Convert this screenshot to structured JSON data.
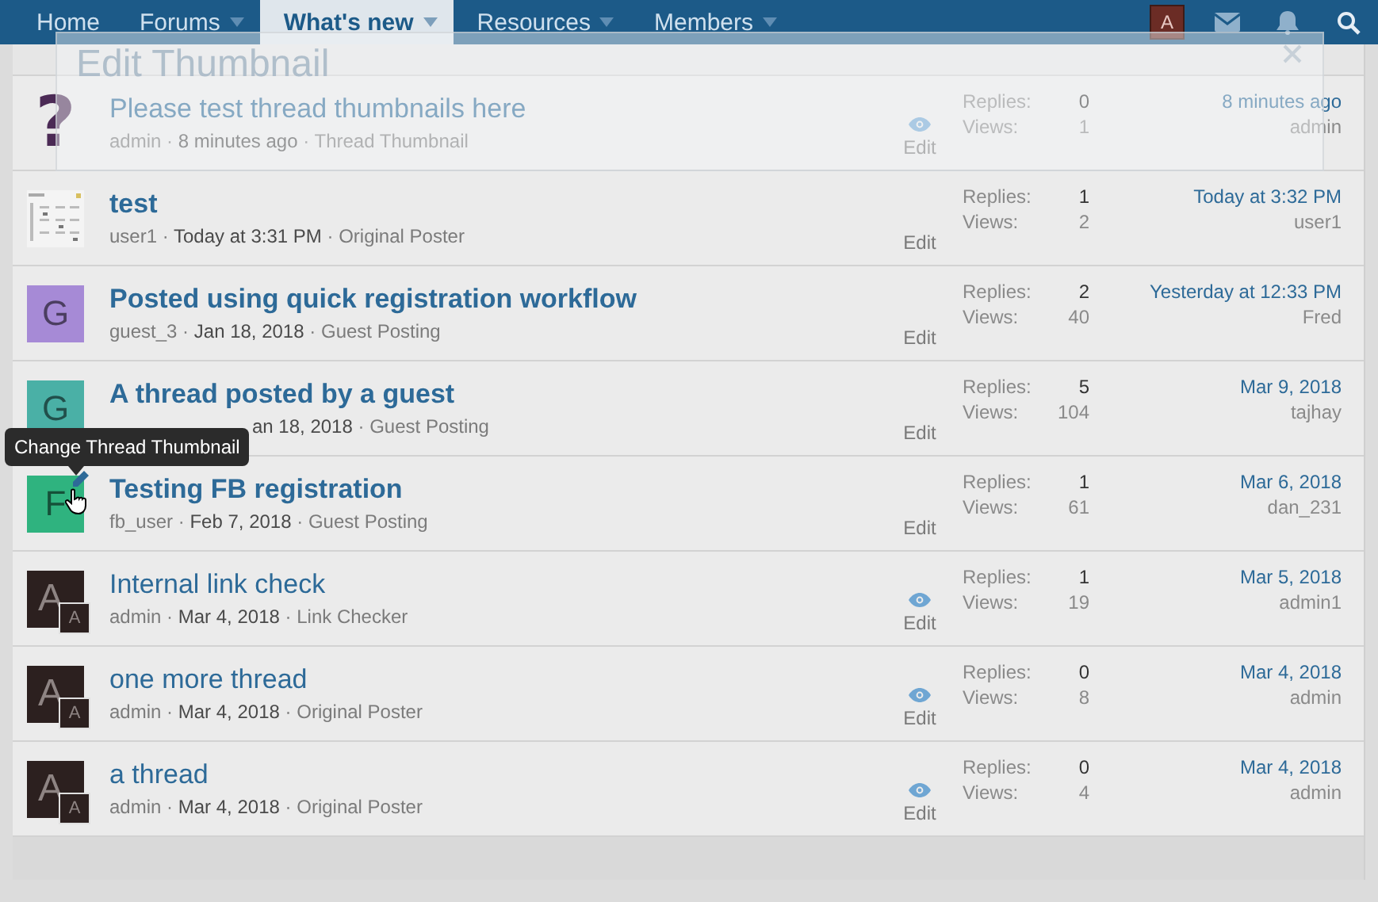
{
  "nav": {
    "items": [
      {
        "label": "Home",
        "selected": false,
        "dropdown": false
      },
      {
        "label": "Forums",
        "selected": false,
        "dropdown": true
      },
      {
        "label": "What's new",
        "selected": true,
        "dropdown": true
      },
      {
        "label": "Resources",
        "selected": false,
        "dropdown": true
      },
      {
        "label": "Members",
        "selected": false,
        "dropdown": true
      }
    ],
    "user_avatar": "A"
  },
  "dialog": {
    "title": "Edit Thumbnail"
  },
  "threads": [
    {
      "avatar": {
        "kind": "question",
        "text": "?"
      },
      "title": "Please test thread thumbnails here",
      "unread": false,
      "meta": [
        {
          "kind": "user",
          "text": "admin"
        },
        {
          "kind": "sep",
          "text": "·"
        },
        {
          "kind": "date",
          "text": "8 minutes ago"
        },
        {
          "kind": "sep",
          "text": "·"
        },
        {
          "kind": "forum",
          "text": "Thread Thumbnail"
        }
      ],
      "preview": true,
      "edit": "Edit",
      "replies_label": "Replies:",
      "replies": "0",
      "views_label": "Views:",
      "views": "1",
      "last_date": "8 minutes ago",
      "last_user": "admin",
      "editing": false
    },
    {
      "avatar": {
        "kind": "image"
      },
      "title": "test",
      "unread": true,
      "meta": [
        {
          "kind": "user",
          "text": "user1"
        },
        {
          "kind": "sep",
          "text": "·"
        },
        {
          "kind": "date",
          "text": "Today at 3:31 PM"
        },
        {
          "kind": "sep",
          "text": "·"
        },
        {
          "kind": "forum",
          "text": "Original Poster"
        }
      ],
      "preview": false,
      "edit": "Edit",
      "replies_label": "Replies:",
      "replies": "1",
      "views_label": "Views:",
      "views": "2",
      "last_date": "Today at 3:32 PM",
      "last_user": "user1",
      "editing": false
    },
    {
      "avatar": {
        "kind": "letter",
        "text": "G",
        "color": "#a68ad6"
      },
      "title": "Posted using quick registration workflow",
      "unread": true,
      "meta": [
        {
          "kind": "user",
          "text": "guest_3"
        },
        {
          "kind": "sep",
          "text": "·"
        },
        {
          "kind": "date",
          "text": "Jan 18, 2018"
        },
        {
          "kind": "sep",
          "text": "·"
        },
        {
          "kind": "forum",
          "text": "Guest Posting"
        }
      ],
      "preview": false,
      "edit": "Edit",
      "replies_label": "Replies:",
      "replies": "2",
      "views_label": "Views:",
      "views": "40",
      "last_date": "Yesterday at 12:33 PM",
      "last_user": "Fred",
      "editing": false
    },
    {
      "avatar": {
        "kind": "letter",
        "text": "G",
        "color": "#4ab0a6"
      },
      "title": "A thread posted by a guest",
      "unread": true,
      "meta": [
        {
          "kind": "date",
          "text": "an 18, 2018"
        },
        {
          "kind": "sep",
          "text": "·"
        },
        {
          "kind": "forum",
          "text": "Guest Posting"
        }
      ],
      "preview": false,
      "edit": "Edit",
      "replies_label": "Replies:",
      "replies": "5",
      "views_label": "Views:",
      "views": "104",
      "last_date": "Mar 9, 2018",
      "last_user": "tajhay",
      "editing": false
    },
    {
      "avatar": {
        "kind": "letter",
        "text": "F",
        "color": "#2fb37f"
      },
      "title": "Testing FB registration",
      "unread": true,
      "meta": [
        {
          "kind": "user",
          "text": "fb_user"
        },
        {
          "kind": "sep",
          "text": "·"
        },
        {
          "kind": "date",
          "text": "Feb 7, 2018"
        },
        {
          "kind": "sep",
          "text": "·"
        },
        {
          "kind": "forum",
          "text": "Guest Posting"
        }
      ],
      "preview": false,
      "edit": "Edit",
      "replies_label": "Replies:",
      "replies": "1",
      "views_label": "Views:",
      "views": "61",
      "last_date": "Mar 6, 2018",
      "last_user": "dan_231",
      "editing": true
    },
    {
      "avatar": {
        "kind": "badge",
        "text": "A",
        "badge": "A"
      },
      "title": "Internal link check",
      "unread": false,
      "meta": [
        {
          "kind": "user",
          "text": "admin"
        },
        {
          "kind": "sep",
          "text": "·"
        },
        {
          "kind": "date",
          "text": "Mar 4, 2018"
        },
        {
          "kind": "sep",
          "text": "·"
        },
        {
          "kind": "forum",
          "text": "Link Checker"
        }
      ],
      "preview": true,
      "edit": "Edit",
      "replies_label": "Replies:",
      "replies": "1",
      "views_label": "Views:",
      "views": "19",
      "last_date": "Mar 5, 2018",
      "last_user": "admin1",
      "editing": false
    },
    {
      "avatar": {
        "kind": "badge",
        "text": "A",
        "badge": "A"
      },
      "title": "one more thread",
      "unread": false,
      "meta": [
        {
          "kind": "user",
          "text": "admin"
        },
        {
          "kind": "sep",
          "text": "·"
        },
        {
          "kind": "date",
          "text": "Mar 4, 2018"
        },
        {
          "kind": "sep",
          "text": "·"
        },
        {
          "kind": "forum",
          "text": "Original Poster"
        }
      ],
      "preview": true,
      "edit": "Edit",
      "replies_label": "Replies:",
      "replies": "0",
      "views_label": "Views:",
      "views": "8",
      "last_date": "Mar 4, 2018",
      "last_user": "admin",
      "editing": false
    },
    {
      "avatar": {
        "kind": "badge",
        "text": "A",
        "badge": "A"
      },
      "title": "a thread",
      "unread": false,
      "meta": [
        {
          "kind": "user",
          "text": "admin"
        },
        {
          "kind": "sep",
          "text": "·"
        },
        {
          "kind": "date",
          "text": "Mar 4, 2018"
        },
        {
          "kind": "sep",
          "text": "·"
        },
        {
          "kind": "forum",
          "text": "Original Poster"
        }
      ],
      "preview": true,
      "edit": "Edit",
      "replies_label": "Replies:",
      "replies": "0",
      "views_label": "Views:",
      "views": "4",
      "last_date": "Mar 4, 2018",
      "last_user": "admin",
      "editing": false
    }
  ],
  "tooltip": {
    "text": "Change Thread Thumbnail"
  }
}
